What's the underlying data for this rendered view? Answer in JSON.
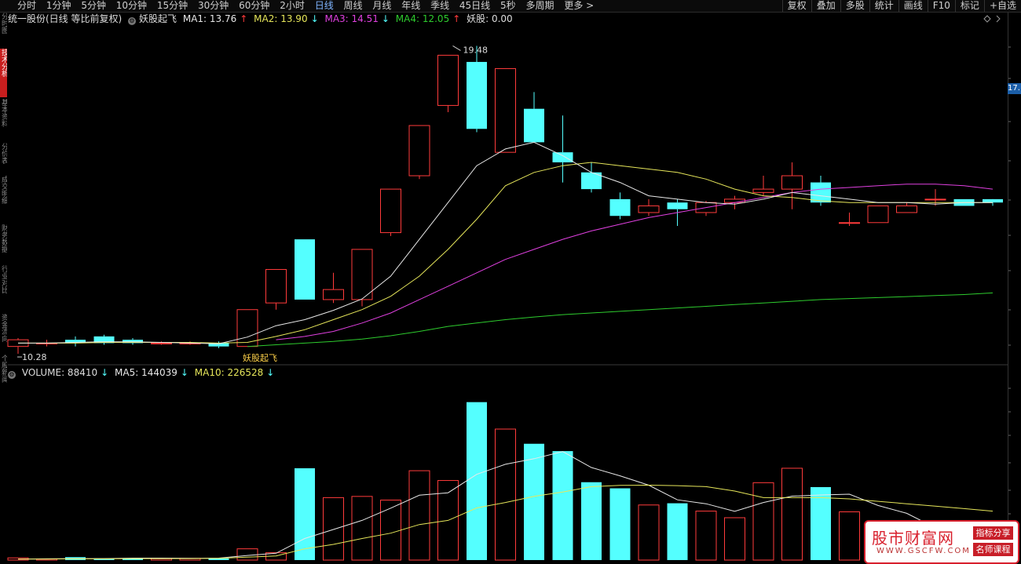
{
  "toolbar": {
    "periods": [
      "分时",
      "1分钟",
      "5分钟",
      "10分钟",
      "15分钟",
      "30分钟",
      "60分钟",
      "2小时",
      "日线",
      "周线",
      "月线",
      "年线",
      "季线",
      "45日线",
      "5秒",
      "多周期",
      "更多 >"
    ],
    "active_period": "日线",
    "tools": [
      "复权",
      "叠加",
      "多股",
      "统计",
      "画线",
      "F10",
      "标记",
      "+自选"
    ]
  },
  "leftbar": {
    "tabs": [
      "分时图",
      "技术分析",
      "基本资料",
      "分价表",
      "成交明细",
      "财务数据",
      "行业对比",
      "资金流向",
      "个股新闻",
      "全景"
    ]
  },
  "info": {
    "stock": "统一股份(日线 等比前复权)",
    "indicator": "妖股起飞",
    "ma1": "MA1: 13.76",
    "ma1_arrow": "↑",
    "ma2": "MA2: 13.90",
    "ma2_arrow": "↓",
    "ma3": "MA3: 14.51",
    "ma3_arrow": "↓",
    "ma4": "MA4: 12.05",
    "ma4_arrow": "↑",
    "yaogu": "妖股: 0.00"
  },
  "volume_info": {
    "volume": "VOLUME: 88410",
    "volume_arrow": "↓",
    "ma5": "MA5: 144039",
    "ma5_arrow": "↓",
    "ma10": "MA10: 226528",
    "ma10_arrow": "↓"
  },
  "annotations": {
    "high": "19.48",
    "low": "10.28",
    "signal": "妖股起飞"
  },
  "right_axis": {
    "last_price": "17."
  },
  "watermark": {
    "title": "股市财富网",
    "url": "WWW.GSCFW.COM",
    "badge1": "指标分享",
    "badge2": "名师课程"
  },
  "colors": {
    "up": "#ff3b3b",
    "down": "#54ffff",
    "ma1": "#e8e8e8",
    "ma2": "#e6e65a",
    "ma3": "#e040e0",
    "ma4": "#2ecc2e"
  },
  "chart_data": {
    "type": "candlestick",
    "candles": [
      {
        "o": 10.5,
        "c": 10.7,
        "h": 10.75,
        "l": 10.28
      },
      {
        "o": 10.6,
        "c": 10.6,
        "h": 10.7,
        "l": 10.5
      },
      {
        "o": 10.7,
        "c": 10.6,
        "h": 10.8,
        "l": 10.5
      },
      {
        "o": 10.8,
        "c": 10.6,
        "h": 10.85,
        "l": 10.55
      },
      {
        "o": 10.7,
        "c": 10.6,
        "h": 10.75,
        "l": 10.55
      },
      {
        "o": 10.6,
        "c": 10.6,
        "h": 10.65,
        "l": 10.55
      },
      {
        "o": 10.6,
        "c": 10.6,
        "h": 10.65,
        "l": 10.55
      },
      {
        "o": 10.6,
        "c": 10.5,
        "h": 10.65,
        "l": 10.45
      },
      {
        "o": 10.5,
        "c": 11.6,
        "h": 11.6,
        "l": 10.5
      },
      {
        "o": 11.8,
        "c": 12.8,
        "h": 12.8,
        "l": 11.6
      },
      {
        "o": 13.7,
        "c": 11.9,
        "h": 13.7,
        "l": 11.9
      },
      {
        "o": 11.9,
        "c": 12.2,
        "h": 12.7,
        "l": 11.8
      },
      {
        "o": 11.9,
        "c": 13.4,
        "h": 13.4,
        "l": 11.7
      },
      {
        "o": 13.9,
        "c": 15.2,
        "h": 15.2,
        "l": 13.8
      },
      {
        "o": 15.6,
        "c": 17.1,
        "h": 17.1,
        "l": 15.5
      },
      {
        "o": 17.7,
        "c": 19.2,
        "h": 19.2,
        "l": 17.5
      },
      {
        "o": 19.0,
        "c": 17.0,
        "h": 19.48,
        "l": 16.9
      },
      {
        "o": 16.3,
        "c": 18.8,
        "h": 18.8,
        "l": 16.3
      },
      {
        "o": 17.6,
        "c": 16.6,
        "h": 18.1,
        "l": 16.6
      },
      {
        "o": 16.3,
        "c": 16.0,
        "h": 17.4,
        "l": 15.4
      },
      {
        "o": 15.7,
        "c": 15.2,
        "h": 16.0,
        "l": 15.1
      },
      {
        "o": 14.9,
        "c": 14.4,
        "h": 15.1,
        "l": 14.3
      },
      {
        "o": 14.5,
        "c": 14.7,
        "h": 14.9,
        "l": 14.4
      },
      {
        "o": 14.8,
        "c": 14.6,
        "h": 14.9,
        "l": 14.1
      },
      {
        "o": 14.5,
        "c": 14.8,
        "h": 14.85,
        "l": 14.4
      },
      {
        "o": 14.8,
        "c": 14.9,
        "h": 15.0,
        "l": 14.6
      },
      {
        "o": 15.1,
        "c": 15.2,
        "h": 15.6,
        "l": 15.0
      },
      {
        "o": 15.2,
        "c": 15.6,
        "h": 16.0,
        "l": 14.6
      },
      {
        "o": 15.4,
        "c": 14.8,
        "h": 15.6,
        "l": 14.7
      },
      {
        "o": 14.2,
        "c": 14.2,
        "h": 14.5,
        "l": 14.1
      },
      {
        "o": 14.2,
        "c": 14.7,
        "h": 14.7,
        "l": 14.2
      },
      {
        "o": 14.5,
        "c": 14.7,
        "h": 14.8,
        "l": 14.5
      },
      {
        "o": 14.9,
        "c": 14.9,
        "h": 15.2,
        "l": 14.7
      },
      {
        "o": 14.9,
        "c": 14.7,
        "h": 14.9,
        "l": 14.7
      },
      {
        "o": 14.9,
        "c": 14.8,
        "h": 14.85,
        "l": 14.7
      }
    ],
    "ma1": [
      10.6,
      10.6,
      10.62,
      10.64,
      10.64,
      10.62,
      10.6,
      10.58,
      10.78,
      11.12,
      11.3,
      11.58,
      11.92,
      12.6,
      13.7,
      14.8,
      15.9,
      16.4,
      16.6,
      16.2,
      15.7,
      15.4,
      15.0,
      14.9,
      14.8,
      14.75,
      14.9,
      15.1,
      15.0,
      14.9,
      14.8,
      14.8,
      14.75,
      14.8,
      14.8
    ],
    "ma2": [
      10.6,
      10.6,
      10.6,
      10.62,
      10.62,
      10.62,
      10.62,
      10.6,
      10.62,
      10.8,
      11.0,
      11.3,
      11.6,
      12.0,
      12.6,
      13.4,
      14.3,
      15.3,
      15.7,
      15.9,
      16.0,
      15.9,
      15.8,
      15.7,
      15.5,
      15.2,
      15.0,
      14.95,
      14.85,
      14.8,
      14.8,
      14.8,
      14.8,
      14.8,
      14.8
    ],
    "ma3": [
      null,
      null,
      null,
      null,
      null,
      null,
      null,
      null,
      null,
      10.7,
      10.8,
      10.95,
      11.2,
      11.5,
      11.9,
      12.3,
      12.7,
      13.1,
      13.4,
      13.7,
      13.95,
      14.15,
      14.35,
      14.5,
      14.65,
      14.8,
      14.95,
      15.1,
      15.2,
      15.25,
      15.3,
      15.35,
      15.35,
      15.3,
      15.2
    ],
    "ma4": [
      null,
      null,
      null,
      null,
      null,
      null,
      null,
      null,
      10.5,
      10.55,
      10.6,
      10.65,
      10.72,
      10.82,
      10.95,
      11.1,
      11.2,
      11.3,
      11.38,
      11.45,
      11.5,
      11.55,
      11.6,
      11.65,
      11.7,
      11.75,
      11.8,
      11.85,
      11.9,
      11.93,
      11.96,
      11.99,
      12.02,
      12.05,
      12.1
    ],
    "ylim": [
      10.0,
      20.1
    ],
    "volume": [
      9,
      5,
      12,
      7,
      7,
      6,
      7,
      7,
      46,
      30,
      375,
      255,
      260,
      245,
      365,
      325,
      645,
      535,
      475,
      445,
      318,
      293,
      225,
      232,
      200,
      173,
      316,
      375,
      298,
      197,
      98,
      72,
      103,
      68,
      53
    ],
    "vol_ma5": [
      4,
      5,
      6,
      6,
      8,
      8,
      7,
      8,
      19,
      28,
      88,
      125,
      162,
      212,
      265,
      275,
      350,
      391,
      414,
      443,
      378,
      344,
      306,
      246,
      230,
      199,
      235,
      261,
      266,
      269,
      223,
      191,
      132,
      100,
      75
    ],
    "vol_ma10": [
      4,
      4,
      5,
      5,
      6,
      6,
      6,
      7,
      12,
      17,
      46,
      64,
      88,
      110,
      145,
      162,
      213,
      235,
      260,
      278,
      300,
      305,
      306,
      304,
      300,
      282,
      255,
      255,
      255,
      250,
      240,
      230,
      220,
      210,
      200
    ],
    "vol_ylim": [
      0,
      740
    ]
  }
}
